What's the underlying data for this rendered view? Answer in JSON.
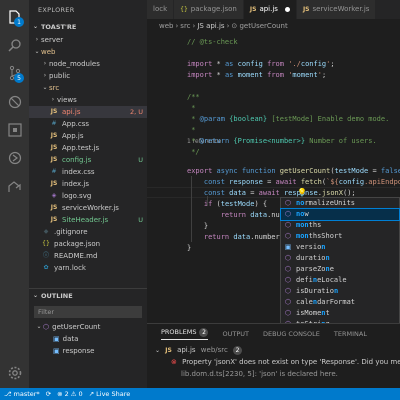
{
  "activity_bar": {
    "explorer_badge": "1",
    "scm_badge": "5",
    "icons": [
      "files-icon",
      "search-icon",
      "source-control-icon",
      "debug-icon",
      "extensions-icon",
      "remote-icon",
      "live-share-icon",
      "testing-icon",
      "gear-icon"
    ]
  },
  "explorer": {
    "title": "EXPLORER",
    "section": "TOAST'RE",
    "tree": [
      {
        "label": "server",
        "icon": "folder-icon",
        "indent": 1,
        "chevron": "›",
        "deco": "",
        "deco_class": ""
      },
      {
        "label": "web",
        "icon": "folder-icon",
        "indent": 1,
        "chevron": "⌄",
        "deco": "",
        "deco_class": "mod",
        "label_class": "mod"
      },
      {
        "label": "node_modules",
        "icon": "folder-icon",
        "indent": 2,
        "chevron": "›",
        "deco": "",
        "deco_class": ""
      },
      {
        "label": "public",
        "icon": "folder-icon",
        "indent": 2,
        "chevron": "›",
        "deco": "",
        "deco_class": ""
      },
      {
        "label": "src",
        "icon": "folder-icon",
        "indent": 2,
        "chevron": "⌄",
        "deco": "",
        "deco_class": "mod",
        "label_class": "mod"
      },
      {
        "label": "views",
        "icon": "folder-icon",
        "indent": 3,
        "chevron": "›",
        "deco": "",
        "deco_class": ""
      },
      {
        "label": "api.js",
        "icon": "js",
        "indent": 3,
        "chevron": "",
        "deco": "2, U",
        "deco_class": "err",
        "label_class": "err",
        "selected": true
      },
      {
        "label": "App.css",
        "icon": "css",
        "indent": 3,
        "chevron": "",
        "deco": "",
        "deco_class": ""
      },
      {
        "label": "App.js",
        "icon": "js",
        "indent": 3,
        "chevron": "",
        "deco": "",
        "deco_class": ""
      },
      {
        "label": "App.test.js",
        "icon": "js",
        "indent": 3,
        "chevron": "",
        "deco": "",
        "deco_class": ""
      },
      {
        "label": "config.js",
        "icon": "js",
        "indent": 3,
        "chevron": "",
        "deco": "U",
        "deco_class": "untr",
        "label_class": "untr"
      },
      {
        "label": "index.css",
        "icon": "css",
        "indent": 3,
        "chevron": "",
        "deco": "",
        "deco_class": ""
      },
      {
        "label": "index.js",
        "icon": "js",
        "indent": 3,
        "chevron": "",
        "deco": "",
        "deco_class": ""
      },
      {
        "label": "logo.svg",
        "icon": "svg",
        "indent": 3,
        "chevron": "",
        "deco": "",
        "deco_class": ""
      },
      {
        "label": "serviceWorker.js",
        "icon": "js",
        "indent": 3,
        "chevron": "",
        "deco": "",
        "deco_class": ""
      },
      {
        "label": "SiteHeader.js",
        "icon": "js",
        "indent": 3,
        "chevron": "",
        "deco": "U",
        "deco_class": "untr",
        "label_class": "untr"
      },
      {
        "label": ".gitignore",
        "icon": "git",
        "indent": 2,
        "chevron": "",
        "deco": "",
        "deco_class": ""
      },
      {
        "label": "package.json",
        "icon": "json",
        "indent": 2,
        "chevron": "",
        "deco": "",
        "deco_class": ""
      },
      {
        "label": "README.md",
        "icon": "md",
        "indent": 2,
        "chevron": "",
        "deco": "",
        "deco_class": ""
      },
      {
        "label": "yarn.lock",
        "icon": "yarn",
        "indent": 2,
        "chevron": "",
        "deco": "",
        "deco_class": ""
      }
    ]
  },
  "outline": {
    "title": "OUTLINE",
    "filter_placeholder": "Filter",
    "items": [
      {
        "label": "getUserCount",
        "indent": 1,
        "chevron": "⌄",
        "kind": "function"
      },
      {
        "label": "data",
        "indent": 2,
        "chevron": "",
        "kind": "variable"
      },
      {
        "label": "response",
        "indent": 2,
        "chevron": "",
        "kind": "variable"
      }
    ]
  },
  "tabs": [
    {
      "label": "lock",
      "icon": "",
      "active": false,
      "dirty": false
    },
    {
      "label": "package.json",
      "icon": "{}",
      "active": false,
      "dirty": false
    },
    {
      "label": "api.js",
      "icon": "JS",
      "active": true,
      "dirty": true
    },
    {
      "label": "serviceWorker.js",
      "icon": "JS",
      "active": false,
      "dirty": false
    }
  ],
  "breadcrumb": [
    "web",
    "›",
    "src",
    "›",
    "JS api.js",
    "›",
    "⊙ getUserCount"
  ],
  "editor": {
    "codelens": "1 reference",
    "lines": [
      "// @ts-check",
      "",
      "import * as config from './config';",
      "import * as moment from 'moment';",
      "",
      "/**",
      " *",
      " * @param {boolean} [testMode] Enable demo mode.",
      " *",
      " * @return {Promise<number>} Number of users.",
      " */",
      "export async function getUserCount(testMode = false) {",
      "    const response = await fetch(`${config.apiEndpoint}",
      "    const data = await response.jsonX();",
      "    if (testMode) {",
      "        return data.numberServed * moment.no",
      "    }",
      "    return data.numberS",
      "}"
    ]
  },
  "suggest": [
    {
      "label": "normalizeUnits",
      "hl": "no"
    },
    {
      "label": "now",
      "hl": "no"
    },
    {
      "label": "months",
      "hl": "mon"
    },
    {
      "label": "monthsShort",
      "hl": "mon"
    },
    {
      "label": "version",
      "hl": "n"
    },
    {
      "label": "duration",
      "hl": "n"
    },
    {
      "label": "parseZone",
      "hl": "n"
    },
    {
      "label": "defineLocale",
      "hl": "n"
    },
    {
      "label": "isDuration",
      "hl": "n"
    },
    {
      "label": "calendarFormat",
      "hl": "n"
    },
    {
      "label": "isMoment",
      "hl": "n"
    },
    {
      "label": "toString",
      "hl": "n"
    }
  ],
  "panel": {
    "tabs": [
      "PROBLEMS",
      "OUTPUT",
      "DEBUG CONSOLE",
      "TERMINAL"
    ],
    "problems_count": "2",
    "file_label": "api.js",
    "file_path": "web/src",
    "file_count": "2",
    "error_text": "Property 'jsonX' does not exist on type 'Response'. Did you mea",
    "related_text": "lib.dom.d.ts[2230, 5]: 'json' is declared here."
  },
  "status": {
    "branch": "master*",
    "sync": "⟳",
    "errors": "2",
    "warnings": "0",
    "live_share": "Live Share"
  },
  "colors": {
    "accent": "#007acc",
    "error": "#f48771",
    "untracked": "#73c991",
    "modified": "#e2c08d"
  }
}
